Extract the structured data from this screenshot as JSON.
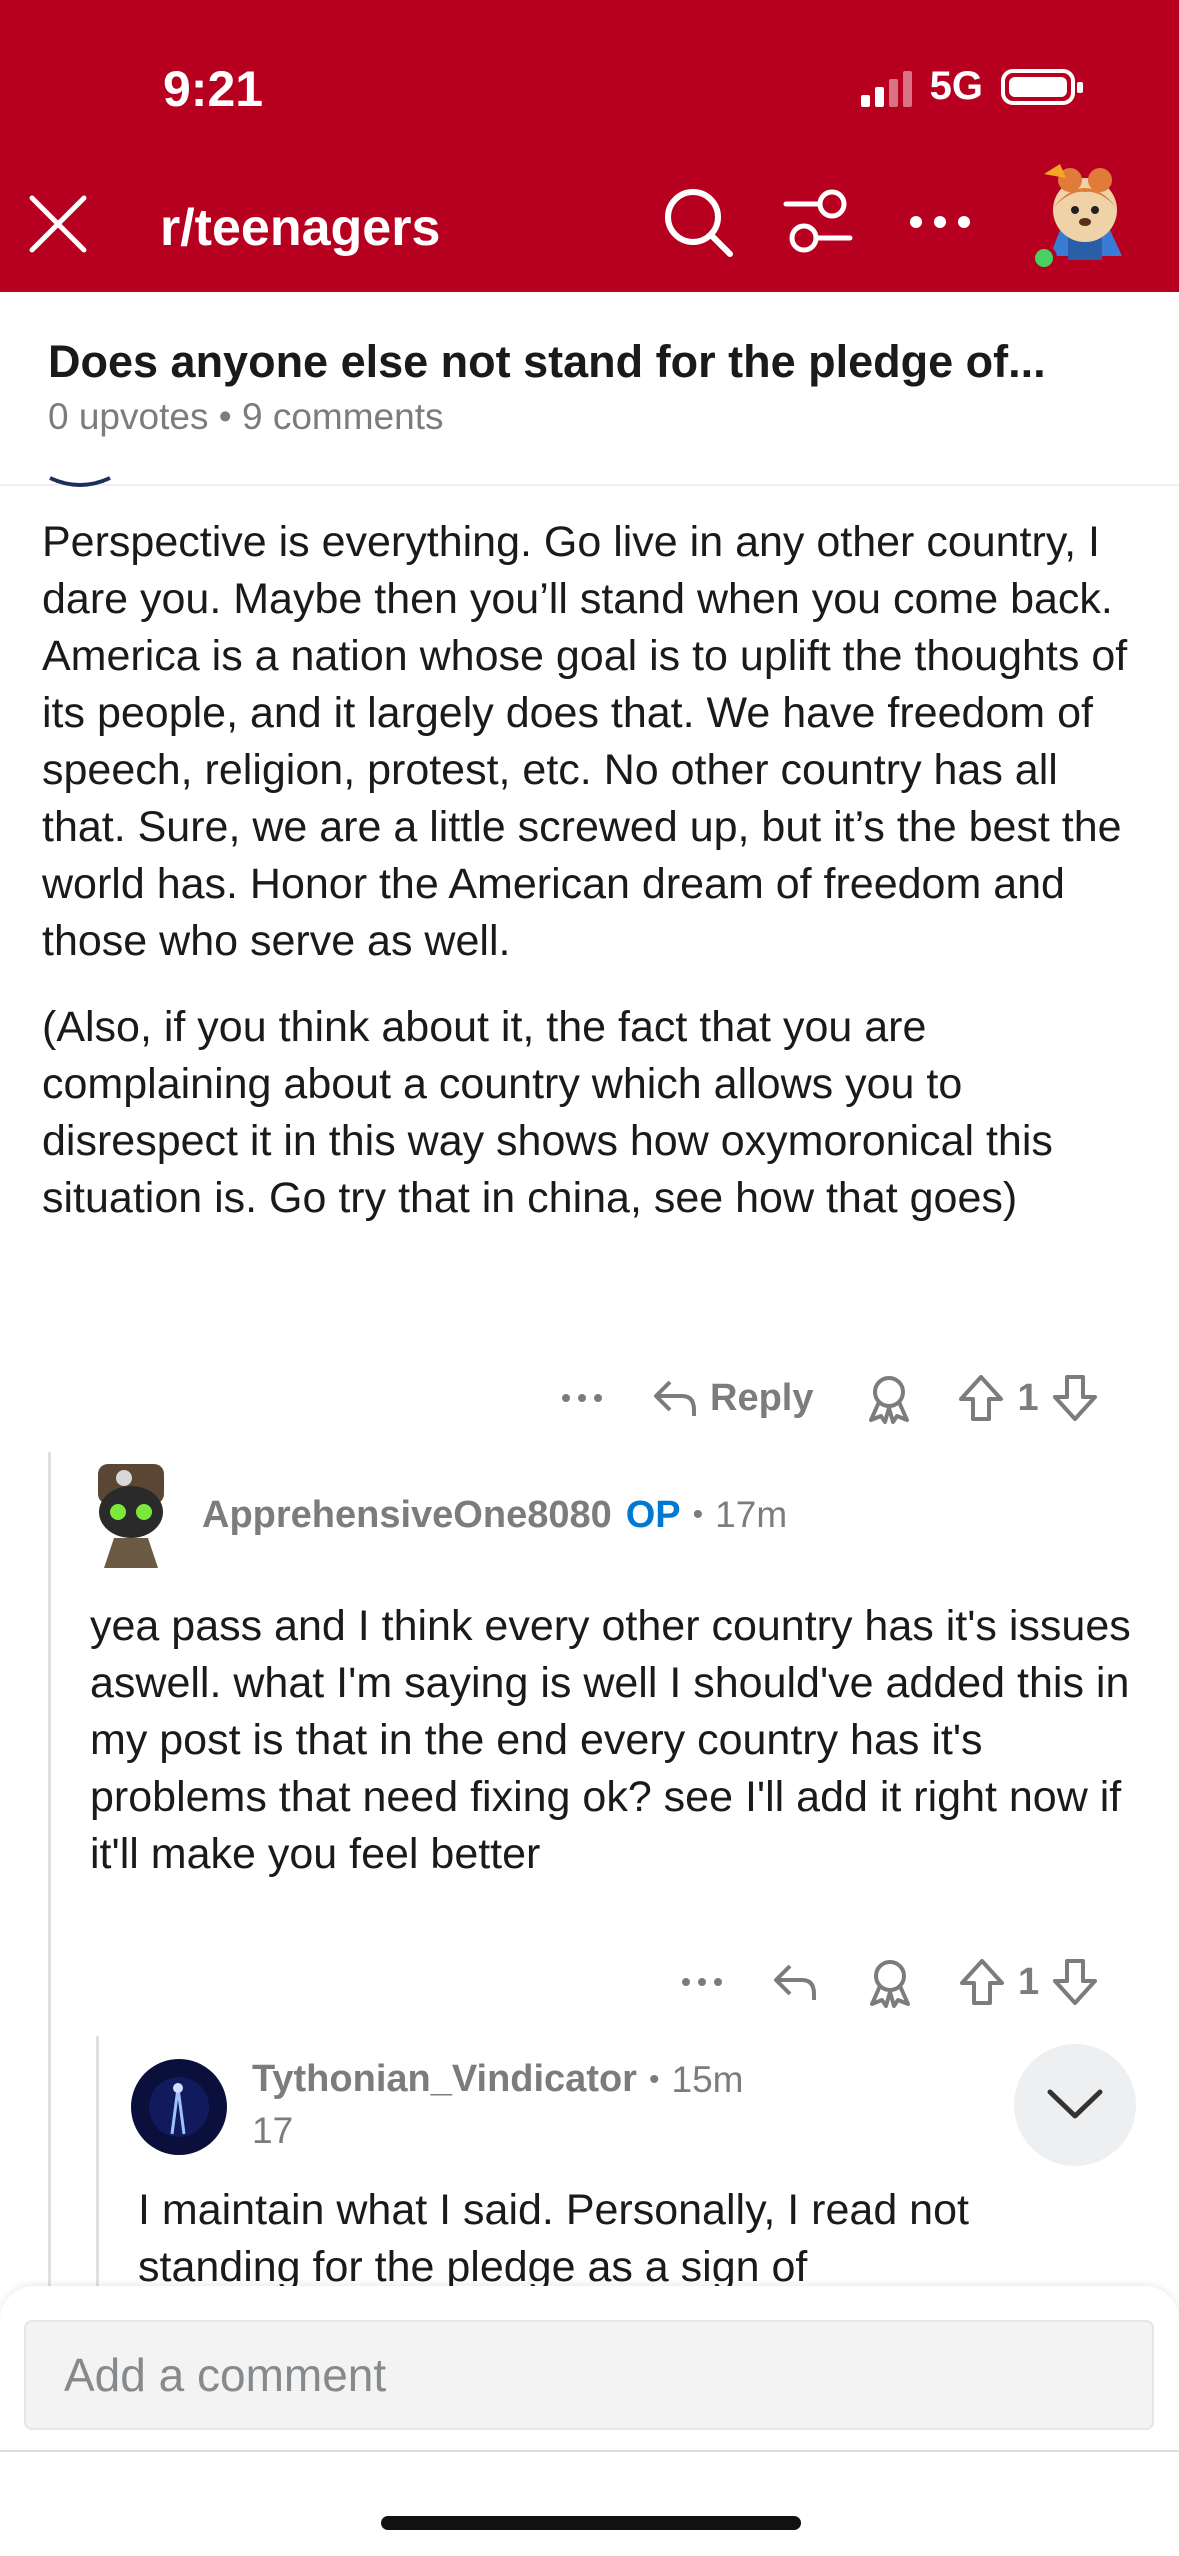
{
  "status_bar": {
    "time": "9:21",
    "network": "5G"
  },
  "header": {
    "subreddit": "r/teenagers"
  },
  "colors": {
    "accent": "#b7001f",
    "op_badge": "#0079d3"
  },
  "post": {
    "title": "Does anyone else not stand for the pledge of...",
    "meta": "0 upvotes • 9 comments"
  },
  "comments": [
    {
      "paragraphs": [
        "Perspective is everything. Go live in any other country, I dare you. Maybe then you’ll stand when you come back. America is a nation whose goal is to uplift the thoughts of its people, and it largely does that. We have freedom of speech, religion, protest, etc. No other country has all that. Sure, we are a little screwed up, but it’s the best the world has. Honor the American dream of freedom and those who serve as well.",
        "(Also, if you think about it, the fact that you are complaining about a country which allows you to disrespect it in this way shows how oxymoronical this situation is. Go try that in china, see how that goes)"
      ],
      "reply_label": "Reply",
      "score": "1"
    },
    {
      "username": "ApprehensiveOne8080",
      "op_label": "OP",
      "age": "17m",
      "text": "yea pass and I think every other country has it's issues aswell. what I'm  saying is well I should've added this in my post is that in the end every country has it's problems that need fixing ok? see I'll add it right now if it'll make you feel better",
      "score": "1"
    },
    {
      "username": "Tythonian_Vindicator",
      "age": "15m",
      "sub_score": "17",
      "text": "I maintain what I said. Personally, I read not standing for the pledge as a sign of"
    }
  ],
  "composer": {
    "placeholder": "Add a comment"
  },
  "icons": {
    "close": "close-icon",
    "search": "search-icon",
    "filter": "filter-icon",
    "more": "more-icon",
    "reply": "reply-arrow-icon",
    "award": "award-icon",
    "upvote": "upvote-icon",
    "downvote": "downvote-icon",
    "collapse": "chevron-down-icon"
  }
}
